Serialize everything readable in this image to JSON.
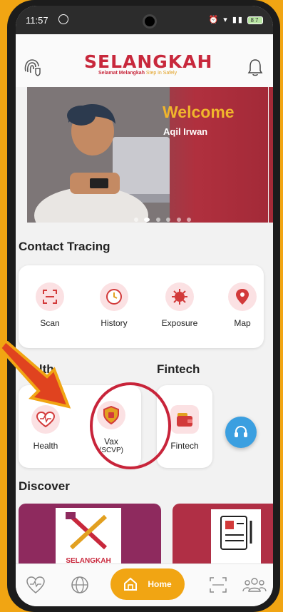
{
  "status_bar": {
    "time": "11:57",
    "battery": "87"
  },
  "header": {
    "logo_text": "SELANGKAH",
    "logo_tagline_1": "Selamat Melangkah",
    "logo_tagline_2": "Step in Safely"
  },
  "banner": {
    "welcome": "Welcome",
    "name": "Aqil Irwan",
    "slide_count": 6,
    "active_slide": 1
  },
  "contact_tracing": {
    "title": "Contact Tracing",
    "items": [
      {
        "label": "Scan",
        "icon": "scan-icon"
      },
      {
        "label": "History",
        "icon": "history-icon"
      },
      {
        "label": "Exposure",
        "icon": "virus-icon"
      },
      {
        "label": "Map",
        "icon": "map-pin-icon"
      }
    ]
  },
  "health": {
    "title": "ealth",
    "items": [
      {
        "label": "Health",
        "icon": "heart-icon"
      },
      {
        "label": "Vax",
        "sublabel": "(SCVP)",
        "icon": "vaccine-shield-icon"
      }
    ]
  },
  "fintech": {
    "title": "Fintech",
    "items": [
      {
        "label": "Fintech",
        "icon": "wallet-icon"
      }
    ]
  },
  "discover": {
    "title": "Discover",
    "card_logo": "SELANGKAH"
  },
  "bottom_nav": {
    "items": [
      {
        "icon": "health-icon"
      },
      {
        "icon": "globe-icon"
      },
      {
        "label": "Home",
        "icon": "home-icon"
      },
      {
        "icon": "scan-icon"
      },
      {
        "icon": "community-icon"
      }
    ]
  },
  "colors": {
    "brand_red": "#c8283c",
    "accent_orange": "#f1a513",
    "float_blue": "#3b9fe0"
  }
}
